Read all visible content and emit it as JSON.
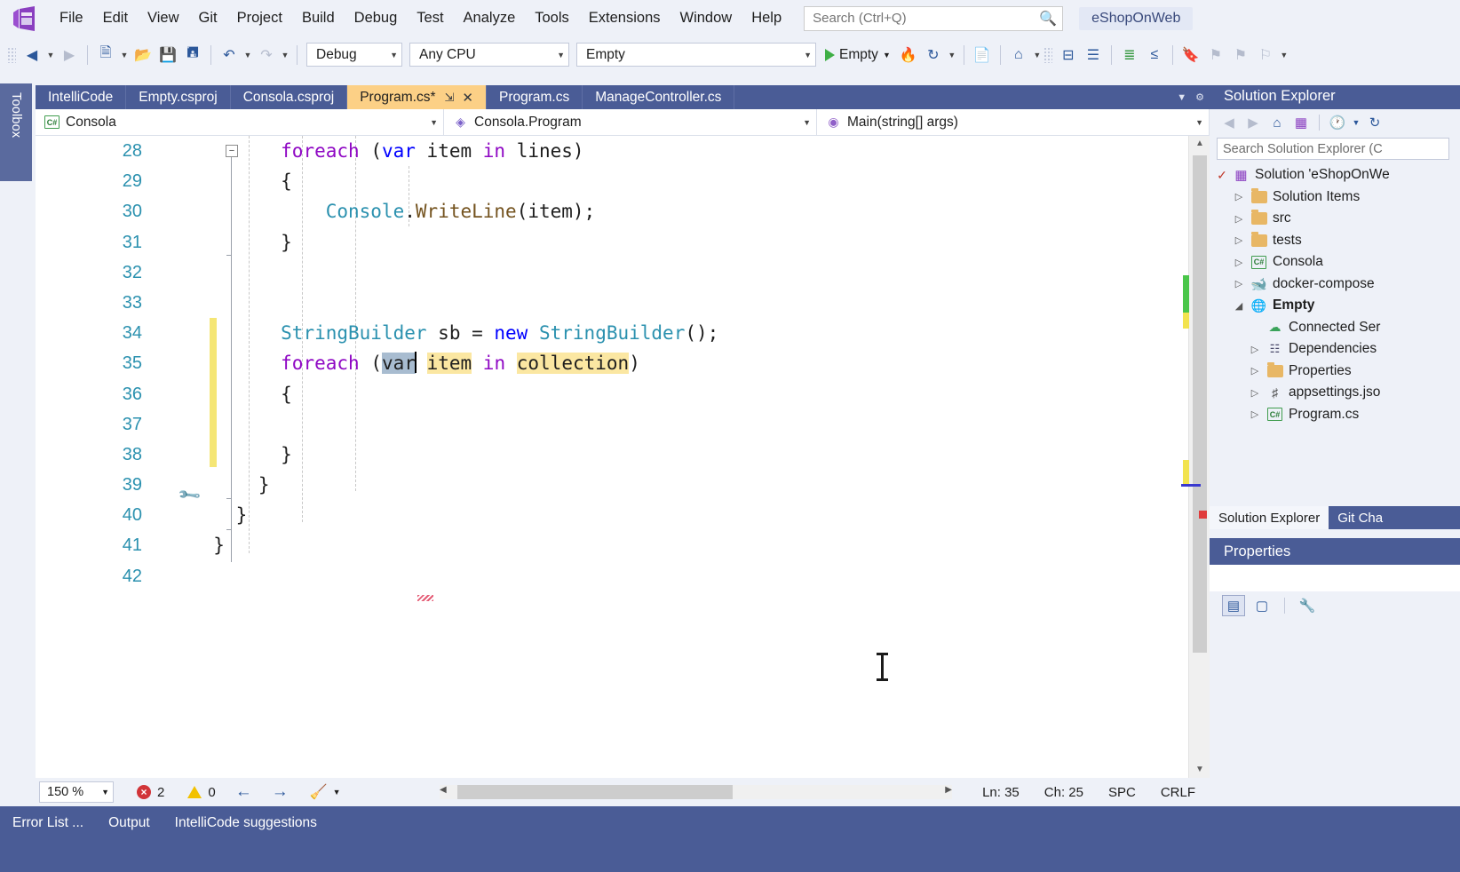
{
  "app": {
    "brand_chip": "eShopOnWeb",
    "accent_blue": "#4a5c96",
    "active_tab_bg": "#fcd086",
    "toolbox_label": "Toolbox"
  },
  "menu": {
    "items": [
      "File",
      "Edit",
      "View",
      "Git",
      "Project",
      "Build",
      "Debug",
      "Test",
      "Analyze",
      "Tools",
      "Extensions",
      "Window",
      "Help"
    ],
    "search_placeholder": "Search (Ctrl+Q)",
    "search_value": "",
    "search_icon": "search-icon"
  },
  "toolbar": {
    "back_icon": "back-arrow-icon",
    "forward_icon": "forward-arrow-icon",
    "new_project_icon": "new-project-icon",
    "open_icon": "open-folder-icon",
    "save_icon": "save-icon",
    "save_all_icon": "save-all-icon",
    "undo_icon": "undo-icon",
    "redo_icon": "redo-icon",
    "configuration": "Debug",
    "platform": "Any CPU",
    "startup_project": "Empty",
    "run_label": "Empty",
    "run_icon": "play-icon",
    "hot_reload_icon": "hot-reload-icon",
    "restart_icon": "restart-icon",
    "selection_icon": "selection-icon",
    "home_icon": "home-icon",
    "window_icon": "window-icon",
    "compare_icon": "compare-icon",
    "indent_icon": "indent-icon",
    "outdent_icon": "outdent-icon",
    "bookmark_icon": "bookmark-icon",
    "next_bookmark_icon": "next-bookmark-icon",
    "prev_bookmark_icon": "prev-bookmark-icon",
    "clear_bookmark_icon": "clear-bookmark-icon",
    "share_icon": "share-icon"
  },
  "editor_tabs": [
    {
      "label": "IntelliCode",
      "active": false,
      "modified": false
    },
    {
      "label": "Empty.csproj",
      "active": false,
      "modified": false
    },
    {
      "label": "Consola.csproj",
      "active": false,
      "modified": false
    },
    {
      "label": "Program.cs*",
      "active": true,
      "modified": true
    },
    {
      "label": "Program.cs",
      "active": false,
      "modified": false
    },
    {
      "label": "ManageController.cs",
      "active": false,
      "modified": false
    }
  ],
  "tab_pin_icon": "pin-icon",
  "tab_close_icon": "close-icon",
  "navbar": {
    "project": "Consola",
    "project_icon": "csharp-project-icon",
    "type": "Consola.Program",
    "type_icon": "class-icon",
    "member": "Main(string[] args)",
    "member_icon": "method-icon"
  },
  "code": {
    "first_line": 28,
    "lines": [
      {
        "n": 28,
        "segs": [
          {
            "t": "        ",
            "c": "plain"
          },
          {
            "t": "foreach",
            "c": "kw"
          },
          {
            "t": " (",
            "c": "plain"
          },
          {
            "t": "var",
            "c": "kw-blue"
          },
          {
            "t": " item ",
            "c": "plain"
          },
          {
            "t": "in",
            "c": "kw"
          },
          {
            "t": " lines)",
            "c": "plain"
          }
        ]
      },
      {
        "n": 29,
        "segs": [
          {
            "t": "        {",
            "c": "plain"
          }
        ]
      },
      {
        "n": 30,
        "segs": [
          {
            "t": "            ",
            "c": "plain"
          },
          {
            "t": "Console",
            "c": "type"
          },
          {
            "t": ".",
            "c": "plain"
          },
          {
            "t": "WriteLine",
            "c": "method"
          },
          {
            "t": "(item);",
            "c": "plain"
          }
        ]
      },
      {
        "n": 31,
        "segs": [
          {
            "t": "        }",
            "c": "plain"
          }
        ]
      },
      {
        "n": 32,
        "segs": []
      },
      {
        "n": 33,
        "segs": []
      },
      {
        "n": 34,
        "segs": [
          {
            "t": "        ",
            "c": "plain"
          },
          {
            "t": "StringBuilder",
            "c": "type"
          },
          {
            "t": " sb = ",
            "c": "plain"
          },
          {
            "t": "new",
            "c": "kw-blue"
          },
          {
            "t": " ",
            "c": "plain"
          },
          {
            "t": "StringBuilder",
            "c": "type"
          },
          {
            "t": "();",
            "c": "plain"
          }
        ]
      },
      {
        "n": 35,
        "segs": [
          {
            "t": "        ",
            "c": "plain"
          },
          {
            "t": "foreach",
            "c": "kw"
          },
          {
            "t": " (",
            "c": "plain"
          },
          {
            "t": "var",
            "c": "sel"
          },
          {
            "t": " ",
            "c": "plain"
          },
          {
            "t": "item",
            "c": "snip"
          },
          {
            "t": " ",
            "c": "plain"
          },
          {
            "t": "in",
            "c": "kw"
          },
          {
            "t": " ",
            "c": "plain"
          },
          {
            "t": "collection",
            "c": "snip"
          },
          {
            "t": ")",
            "c": "plain"
          }
        ]
      },
      {
        "n": 36,
        "segs": [
          {
            "t": "        {",
            "c": "plain"
          }
        ]
      },
      {
        "n": 37,
        "segs": []
      },
      {
        "n": 38,
        "segs": [
          {
            "t": "        }",
            "c": "plain"
          }
        ]
      },
      {
        "n": 39,
        "segs": [
          {
            "t": "      }",
            "c": "plain"
          }
        ]
      },
      {
        "n": 40,
        "segs": [
          {
            "t": "    }",
            "c": "plain"
          }
        ]
      },
      {
        "n": 41,
        "segs": [
          {
            "t": "  }",
            "c": "plain"
          }
        ]
      },
      {
        "n": 42,
        "segs": []
      }
    ],
    "fold_icon": "collapse-fold-icon",
    "lightbulb_icon": "quick-actions-screwdriver-icon",
    "error_squiggle": "error-squiggle"
  },
  "editor_status": {
    "zoom": "150 %",
    "error_count": "2",
    "warning_count": "0",
    "error_icon": "error-icon",
    "warning_icon": "warning-icon",
    "prev_icon": "previous-issue-icon",
    "next_icon": "next-issue-icon",
    "cleanup_icon": "code-cleanup-icon",
    "line": "Ln: 35",
    "column": "Ch: 25",
    "spaces": "SPC",
    "line_endings": "CRLF"
  },
  "bottom_tabs": [
    "Error List ...",
    "Output",
    "IntelliCode suggestions"
  ],
  "solution_explorer": {
    "title": "Solution Explorer",
    "search_placeholder": "Search Solution Explorer (C",
    "toolbar_icons": [
      "back-icon",
      "forward-icon",
      "home-icon",
      "solution-icon",
      "pending-changes-icon",
      "refresh-icon"
    ],
    "tree": [
      {
        "label": "Solution 'eShopOnWe",
        "depth": 0,
        "arrow": "check",
        "icon": "solution-icon",
        "bold": false
      },
      {
        "label": "Solution Items",
        "depth": 1,
        "arrow": "closed",
        "icon": "folder-icon",
        "bold": false
      },
      {
        "label": "src",
        "depth": 1,
        "arrow": "closed",
        "icon": "folder-icon",
        "bold": false
      },
      {
        "label": "tests",
        "depth": 1,
        "arrow": "closed",
        "icon": "folder-icon",
        "bold": false
      },
      {
        "label": "Consola",
        "depth": 1,
        "arrow": "closed",
        "icon": "csharp-project-icon",
        "bold": false
      },
      {
        "label": "docker-compose",
        "depth": 1,
        "arrow": "closed",
        "icon": "docker-icon",
        "bold": false
      },
      {
        "label": "Empty",
        "depth": 1,
        "arrow": "open",
        "icon": "web-project-icon",
        "bold": true
      },
      {
        "label": "Connected Ser",
        "depth": 2,
        "arrow": "none",
        "icon": "connected-services-icon",
        "bold": false
      },
      {
        "label": "Dependencies",
        "depth": 2,
        "arrow": "closed",
        "icon": "dependencies-icon",
        "bold": false
      },
      {
        "label": "Properties",
        "depth": 2,
        "arrow": "closed",
        "icon": "properties-folder-icon",
        "bold": false
      },
      {
        "label": "appsettings.jso",
        "depth": 2,
        "arrow": "closed",
        "icon": "json-file-icon",
        "bold": false
      },
      {
        "label": "Program.cs",
        "depth": 2,
        "arrow": "closed",
        "icon": "csharp-file-icon",
        "bold": false
      }
    ],
    "tabs": [
      {
        "label": "Solution Explorer",
        "active": true
      },
      {
        "label": "Git Cha",
        "active": false
      }
    ]
  },
  "properties": {
    "title": "Properties",
    "toolbar_icons": [
      "categorized-icon",
      "alphabetical-icon",
      "property-pages-icon"
    ]
  }
}
